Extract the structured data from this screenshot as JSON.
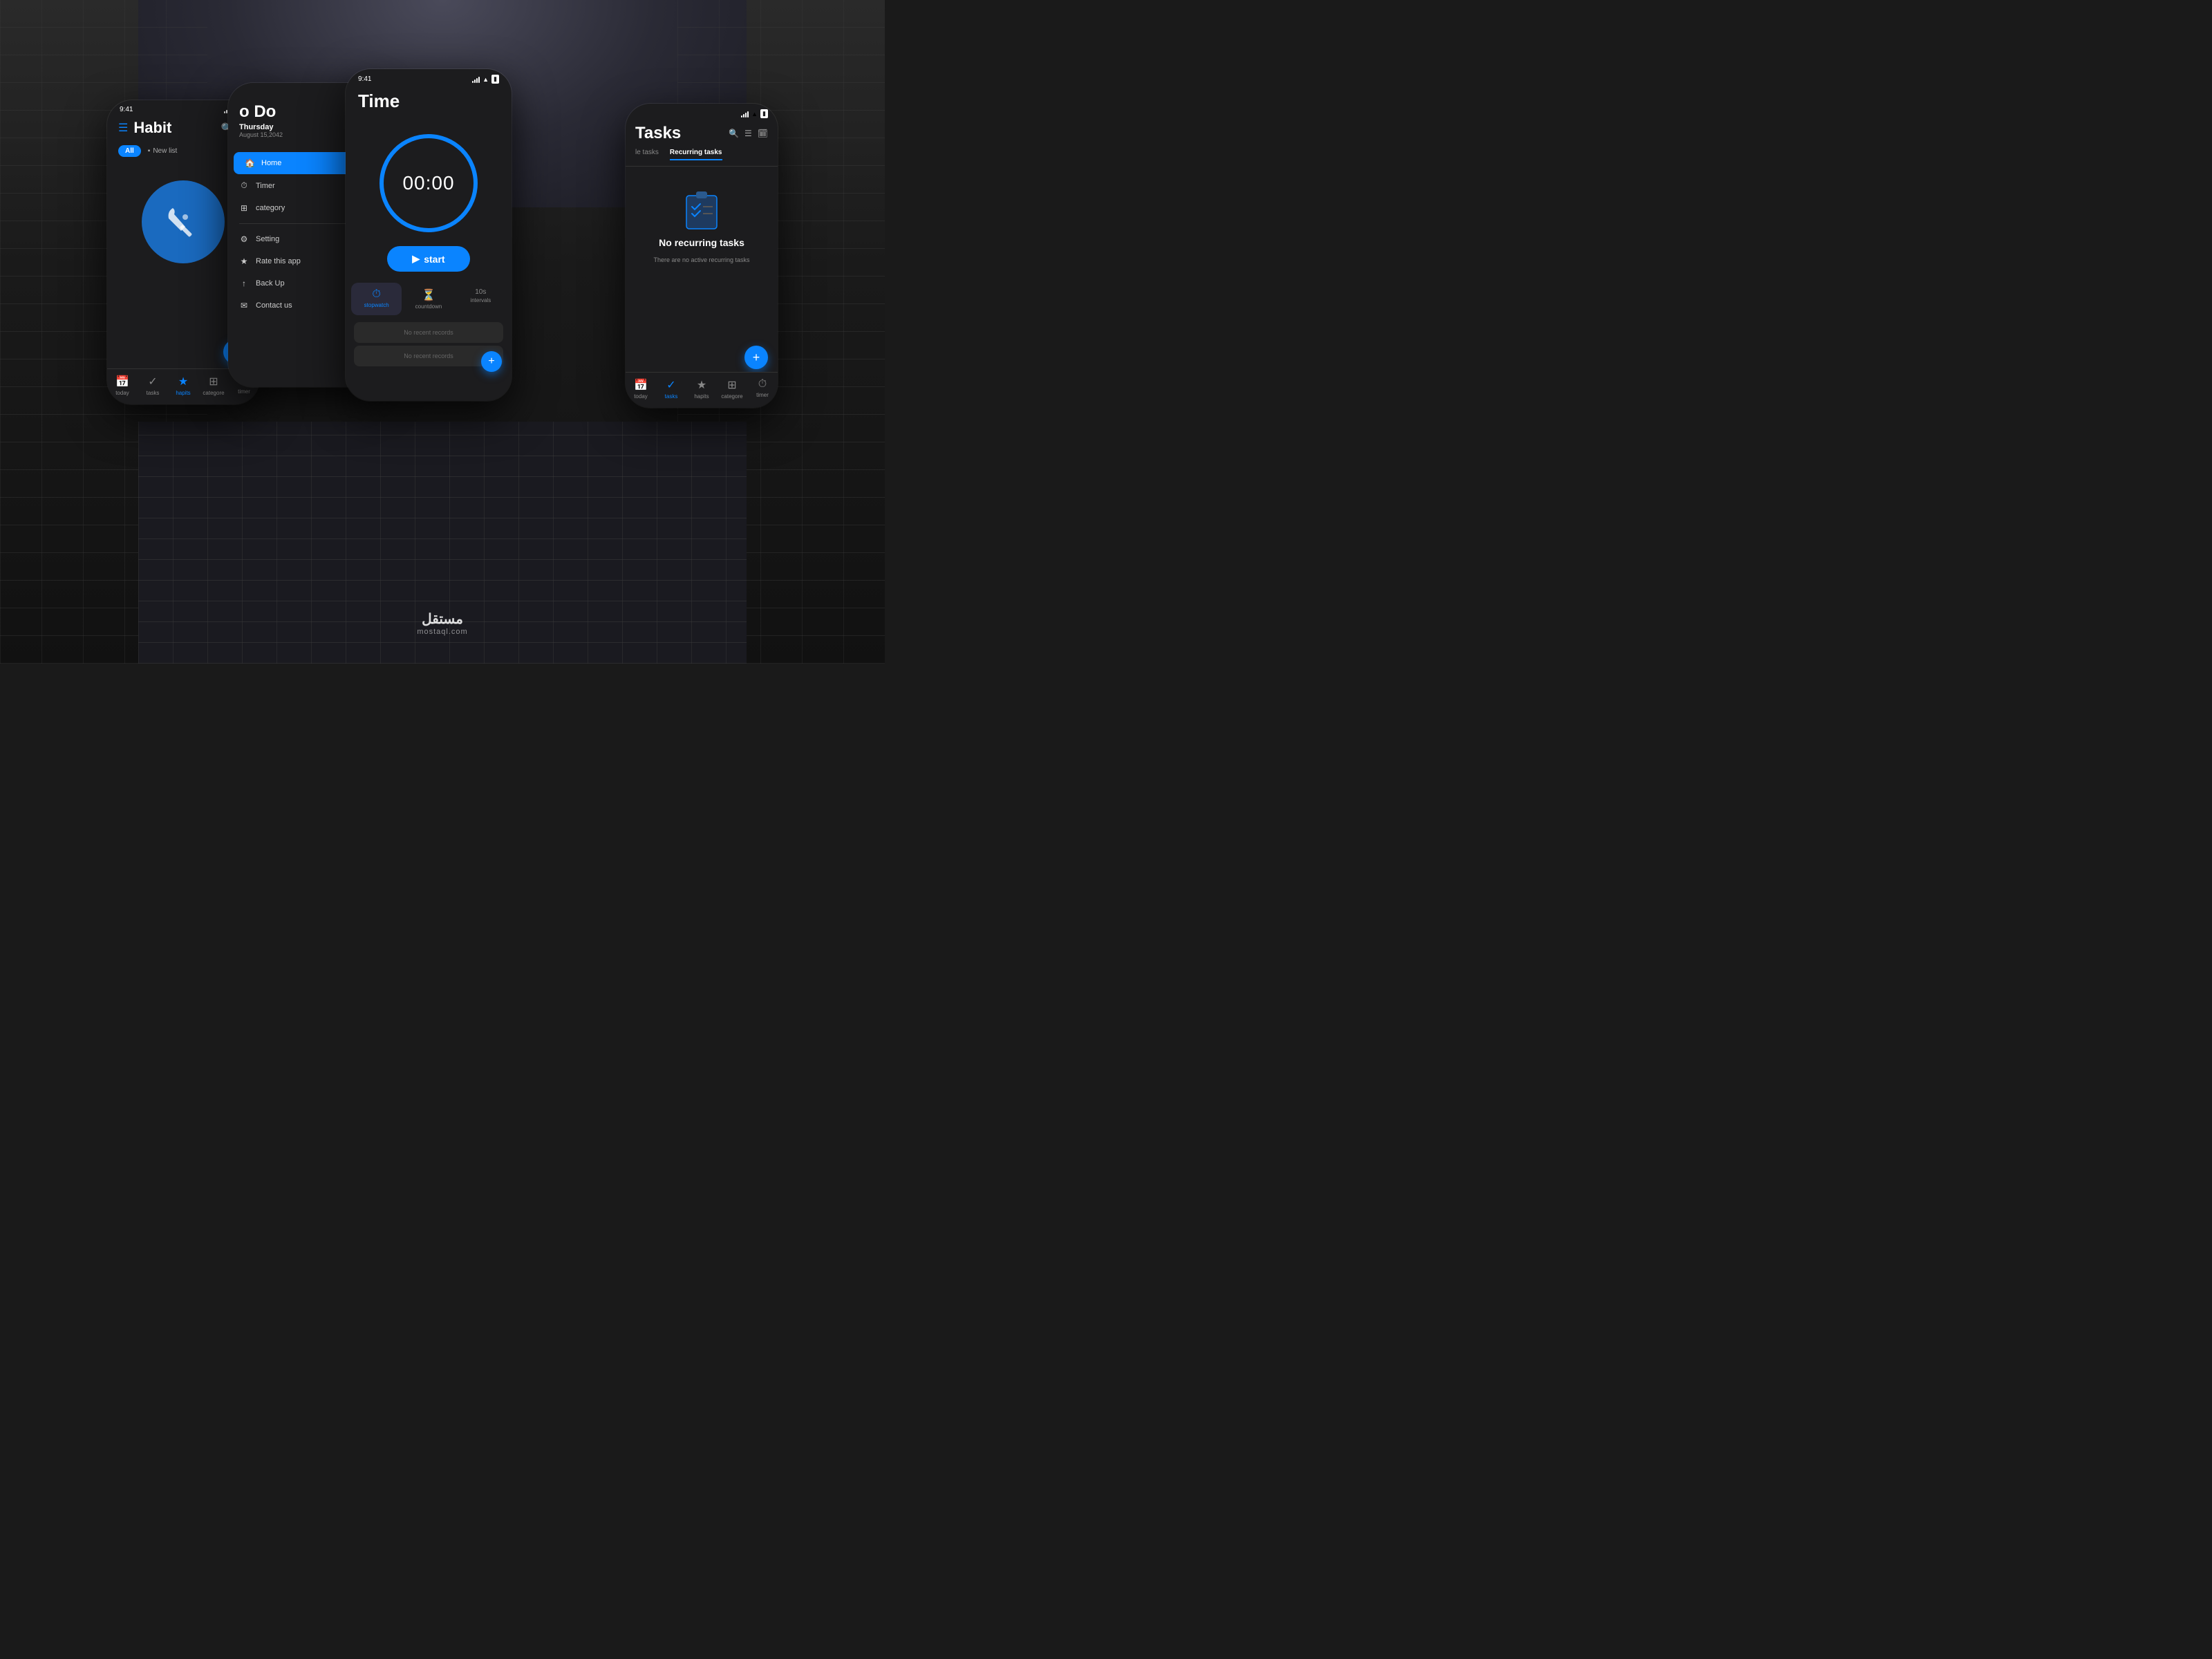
{
  "background": {
    "color": "#1a1a1a"
  },
  "phone_habit": {
    "status": {
      "time": "9:41",
      "signal": "●●●●",
      "wifi": "WiFi",
      "battery": "100%"
    },
    "header": {
      "menu_icon": "☰",
      "title": "Habit",
      "search_icon": "🔍",
      "add_icon": "＋"
    },
    "filter": {
      "all_label": "All",
      "new_list_label": "New list",
      "list_icon": "▪"
    },
    "nav": {
      "items": [
        {
          "icon": "📅",
          "label": "today"
        },
        {
          "icon": "✓",
          "label": "tasks"
        },
        {
          "icon": "★",
          "label": "hapits",
          "active": true
        },
        {
          "icon": "⊞",
          "label": "categore"
        },
        {
          "icon": "⏱",
          "label": "timer"
        }
      ]
    },
    "fab_label": "+"
  },
  "phone_todo": {
    "title": "o Do",
    "subtitle": "Thursday",
    "date": "August 15,2042",
    "menu_items": [
      {
        "icon": "🏠",
        "label": "Home",
        "active": true
      },
      {
        "icon": "⏱",
        "label": "Timer"
      },
      {
        "icon": "⊞",
        "label": "category"
      },
      {
        "icon": "⚙",
        "label": "Setting"
      },
      {
        "icon": "★",
        "label": "Rate this app"
      },
      {
        "icon": "↑",
        "label": "Back Up"
      },
      {
        "icon": "✉",
        "label": "Contact us"
      }
    ]
  },
  "phone_timer": {
    "status": {
      "time": "9:41",
      "signal": "bars",
      "wifi": "WiFi",
      "battery": "■"
    },
    "title": "Time",
    "timer_display": "00:00",
    "start_button": "start",
    "tabs": [
      {
        "icon": "⏱",
        "label": "stopwatch",
        "active": true
      },
      {
        "icon": "⏳",
        "label": "countdown"
      },
      {
        "icon": "🔄",
        "label": "10s intervals"
      }
    ],
    "records": [
      {
        "text": "No recent records"
      },
      {
        "text": "No recent records"
      }
    ],
    "fab": "+"
  },
  "phone_tasks": {
    "status": {
      "signal": "bars",
      "wifi": "WiFi",
      "battery": "■"
    },
    "title": "Tasks",
    "header_icons": {
      "search": "🔍",
      "filter": "☰",
      "add": "🗓"
    },
    "tabs": [
      {
        "label": "le tasks",
        "active": false
      },
      {
        "label": "Recurring tasks",
        "active": true
      }
    ],
    "empty_state": {
      "title": "No recurring tasks",
      "subtitle": "There are no active recurring tasks"
    },
    "fab": "+",
    "nav": {
      "items": [
        {
          "icon": "📅",
          "label": "today"
        },
        {
          "icon": "✓",
          "label": "tasks",
          "active": true
        },
        {
          "icon": "★",
          "label": "hapits"
        },
        {
          "icon": "⊞",
          "label": "categore"
        },
        {
          "icon": "⏱",
          "label": "timer"
        }
      ]
    }
  },
  "watermark": {
    "arabic": "مستقل",
    "url": "mostaql.com"
  }
}
